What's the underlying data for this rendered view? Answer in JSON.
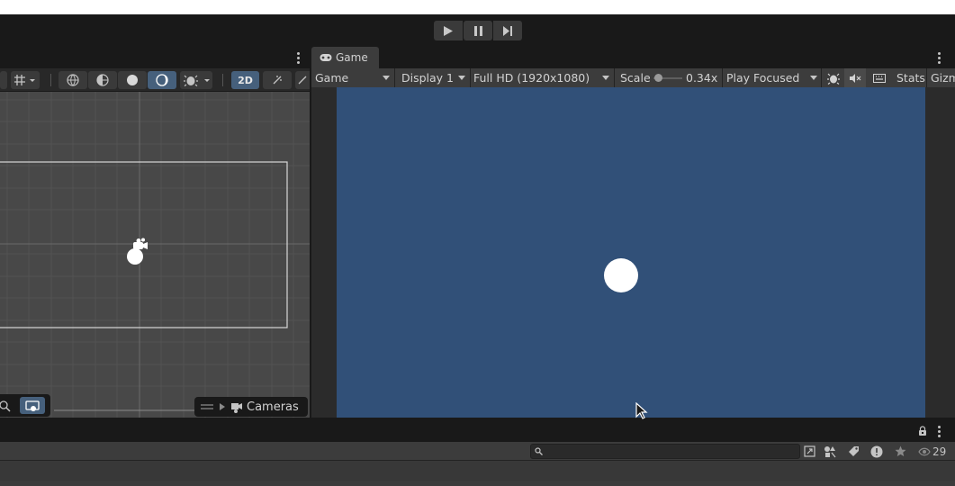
{
  "playmode": {
    "buttons": [
      {
        "name": "play",
        "icon": "play-icon"
      },
      {
        "name": "pause",
        "icon": "pause-icon"
      },
      {
        "name": "step",
        "icon": "step-icon"
      }
    ]
  },
  "scene": {
    "toolbar_2d_label": "2D",
    "cameras_label": "Cameras"
  },
  "game": {
    "tab_label": "Game",
    "view_mode": "Game",
    "display": "Display 1",
    "resolution": "Full HD (1920x1080)",
    "scale_label": "Scale",
    "scale_value": "0.34x",
    "play_mode": "Play Focused",
    "stats_label": "Stats",
    "gizmos_label": "Gizmos",
    "background_color": "#315078"
  },
  "bottom": {
    "search_placeholder": "",
    "hidden_count": "29"
  },
  "colors": {
    "editor_dark": "#191919",
    "panel": "#3c3c3c",
    "scene_bg": "#484848",
    "accent_active": "#46607c"
  }
}
